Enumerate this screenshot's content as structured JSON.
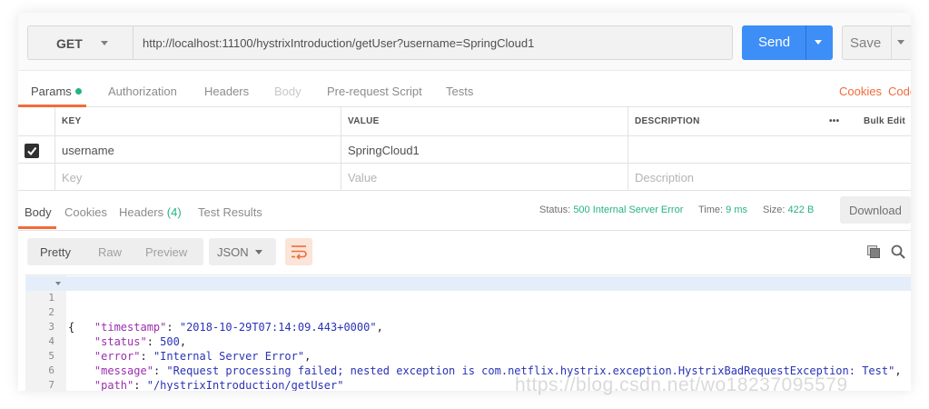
{
  "request": {
    "method": "GET",
    "url": "http://localhost:11100/hystrixIntroduction/getUser?username=SpringCloud1",
    "send_label": "Send",
    "save_label": "Save"
  },
  "request_tabs": [
    {
      "label": "Params",
      "active": true
    },
    {
      "label": "Authorization"
    },
    {
      "label": "Headers"
    },
    {
      "label": "Body",
      "disabled": true
    },
    {
      "label": "Pre-request Script"
    },
    {
      "label": "Tests"
    }
  ],
  "request_links": {
    "cookies": "Cookies",
    "code": "Code"
  },
  "params": {
    "headers": {
      "key": "KEY",
      "value": "VALUE",
      "description": "DESCRIPTION"
    },
    "more_label": "•••",
    "bulk_edit": "Bulk Edit",
    "rows": [
      {
        "checked": true,
        "key": "username",
        "value": "SpringCloud1",
        "description": ""
      }
    ],
    "placeholders": {
      "key": "Key",
      "value": "Value",
      "description": "Description"
    }
  },
  "response": {
    "tabs": [
      {
        "label": "Body",
        "active": true
      },
      {
        "label": "Cookies"
      },
      {
        "label": "Headers",
        "count": "(4)"
      },
      {
        "label": "Test Results"
      }
    ],
    "status_label": "Status:",
    "status_value": "500 Internal Server Error",
    "time_label": "Time:",
    "time_value": "9 ms",
    "size_label": "Size:",
    "size_value": "422 B",
    "download_label": "Download"
  },
  "toolbar": {
    "views": [
      "Pretty",
      "Raw",
      "Preview"
    ],
    "active_view": "Pretty",
    "format": "JSON"
  },
  "body_lines": [
    {
      "n": "1",
      "text": "{"
    },
    {
      "n": "2",
      "key": "\"timestamp\"",
      "value": "\"2018-10-29T07:14:09.443+0000\"",
      "comma": true
    },
    {
      "n": "3",
      "key": "\"status\"",
      "value": "500",
      "comma": true
    },
    {
      "n": "4",
      "key": "\"error\"",
      "value": "\"Internal Server Error\"",
      "comma": true
    },
    {
      "n": "5",
      "key": "\"message\"",
      "value": "\"Request processing failed; nested exception is com.netflix.hystrix.exception.HystrixBadRequestException: Test\"",
      "comma": true
    },
    {
      "n": "6",
      "key": "\"path\"",
      "value": "\"/hystrixIntroduction/getUser\"",
      "comma": false
    },
    {
      "n": "7",
      "text": "}"
    }
  ],
  "watermark": "https://blog.csdn.net/wo18237095579",
  "colors": {
    "accent": "#f26b3a",
    "send_blue": "#3e8ef7",
    "status_green": "#26b47f",
    "json_key": "#9b2fae",
    "json_string": "#2a33b5"
  }
}
